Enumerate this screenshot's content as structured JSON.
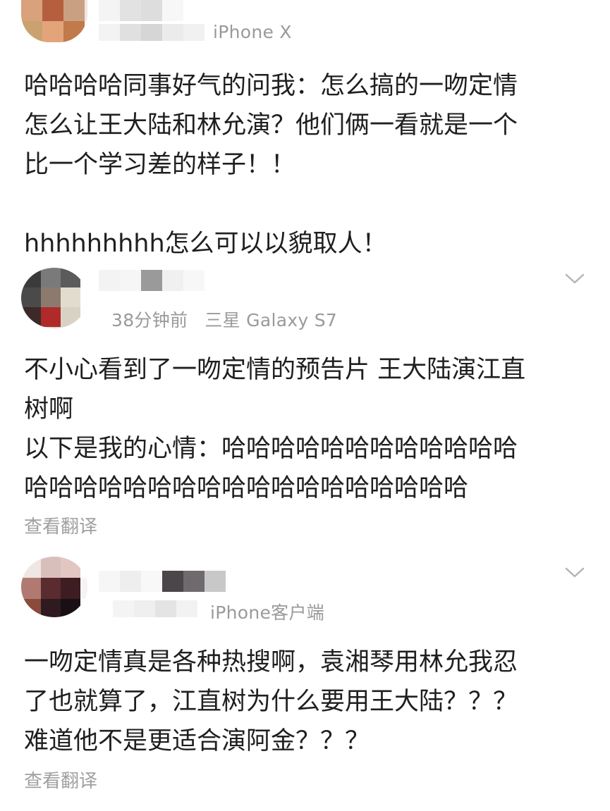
{
  "colors": {
    "text": "#1f1f1f",
    "meta": "#9a9a9a",
    "translate": "#a0a0a0",
    "background": "#ffffff"
  },
  "post1": {
    "meta_device": "iPhone X",
    "lines": [
      "哈哈哈哈同事好气的问我：怎么搞的一吻定情",
      "怎么让王大陆和林允演？他们俩一看就是一个",
      "比一个学习差的样子！！"
    ],
    "line_extra": "hhhhhhhhh怎么可以以貌取人！"
  },
  "post2": {
    "meta_time": "38分钟前",
    "meta_device": "三星 Galaxy S7",
    "lines": [
      "不小心看到了一吻定情的预告片 王大陆演江直",
      "树啊",
      "以下是我的心情：哈哈哈哈哈哈哈哈哈哈哈哈",
      "哈哈哈哈哈哈哈哈哈哈哈哈哈哈哈哈哈哈"
    ],
    "translate_label": "查看翻译",
    "chevron_icon": "chevron-down-icon"
  },
  "post3": {
    "meta_device": "iPhone客户端",
    "lines": [
      "一吻定情真是各种热搜啊，袁湘琴用林允我忍",
      "了也就算了，江直树为什么要用王大陆？？？",
      "难道他不是更适合演阿金？？？"
    ],
    "translate_label": "查看翻译",
    "chevron_icon": "chevron-down-icon"
  }
}
